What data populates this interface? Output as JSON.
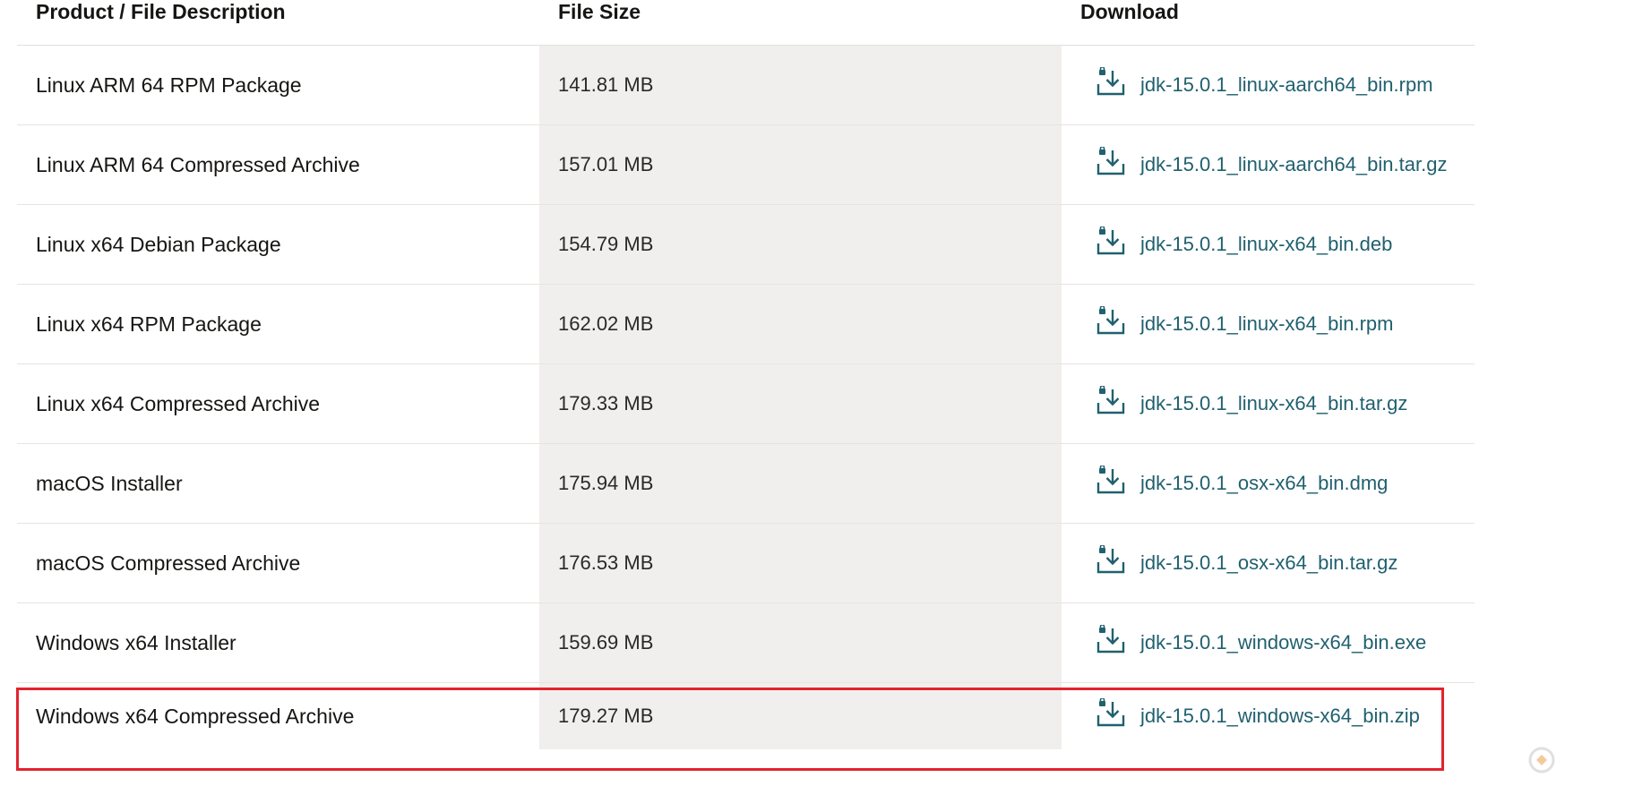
{
  "table": {
    "headers": {
      "description": "Product / File Description",
      "size": "File Size",
      "download": "Download"
    },
    "rows": [
      {
        "description": "Linux ARM 64 RPM Package",
        "size": "141.81 MB",
        "file": "jdk-15.0.1_linux-aarch64_bin.rpm"
      },
      {
        "description": "Linux ARM 64 Compressed Archive",
        "size": "157.01 MB",
        "file": "jdk-15.0.1_linux-aarch64_bin.tar.gz"
      },
      {
        "description": "Linux x64 Debian Package",
        "size": "154.79 MB",
        "file": "jdk-15.0.1_linux-x64_bin.deb"
      },
      {
        "description": "Linux x64 RPM Package",
        "size": "162.02 MB",
        "file": "jdk-15.0.1_linux-x64_bin.rpm"
      },
      {
        "description": "Linux x64 Compressed Archive",
        "size": "179.33 MB",
        "file": "jdk-15.0.1_linux-x64_bin.tar.gz"
      },
      {
        "description": "macOS Installer",
        "size": "175.94 MB",
        "file": "jdk-15.0.1_osx-x64_bin.dmg"
      },
      {
        "description": "macOS Compressed Archive",
        "size": "176.53 MB",
        "file": "jdk-15.0.1_osx-x64_bin.tar.gz"
      },
      {
        "description": "Windows x64 Installer",
        "size": "159.69 MB",
        "file": "jdk-15.0.1_windows-x64_bin.exe"
      },
      {
        "description": "Windows x64 Compressed Archive",
        "size": "179.27 MB",
        "file": "jdk-15.0.1_windows-x64_bin.zip"
      }
    ]
  },
  "highlight": {
    "color": "#e2232f",
    "row_description": "Windows x64 Compressed Archive"
  },
  "icons": {
    "download": "download-lock-icon",
    "watermark": "watermark-logo-icon"
  },
  "colors": {
    "link": "#20606f",
    "size_column_bg": "#f0efed",
    "text": "#161513"
  }
}
